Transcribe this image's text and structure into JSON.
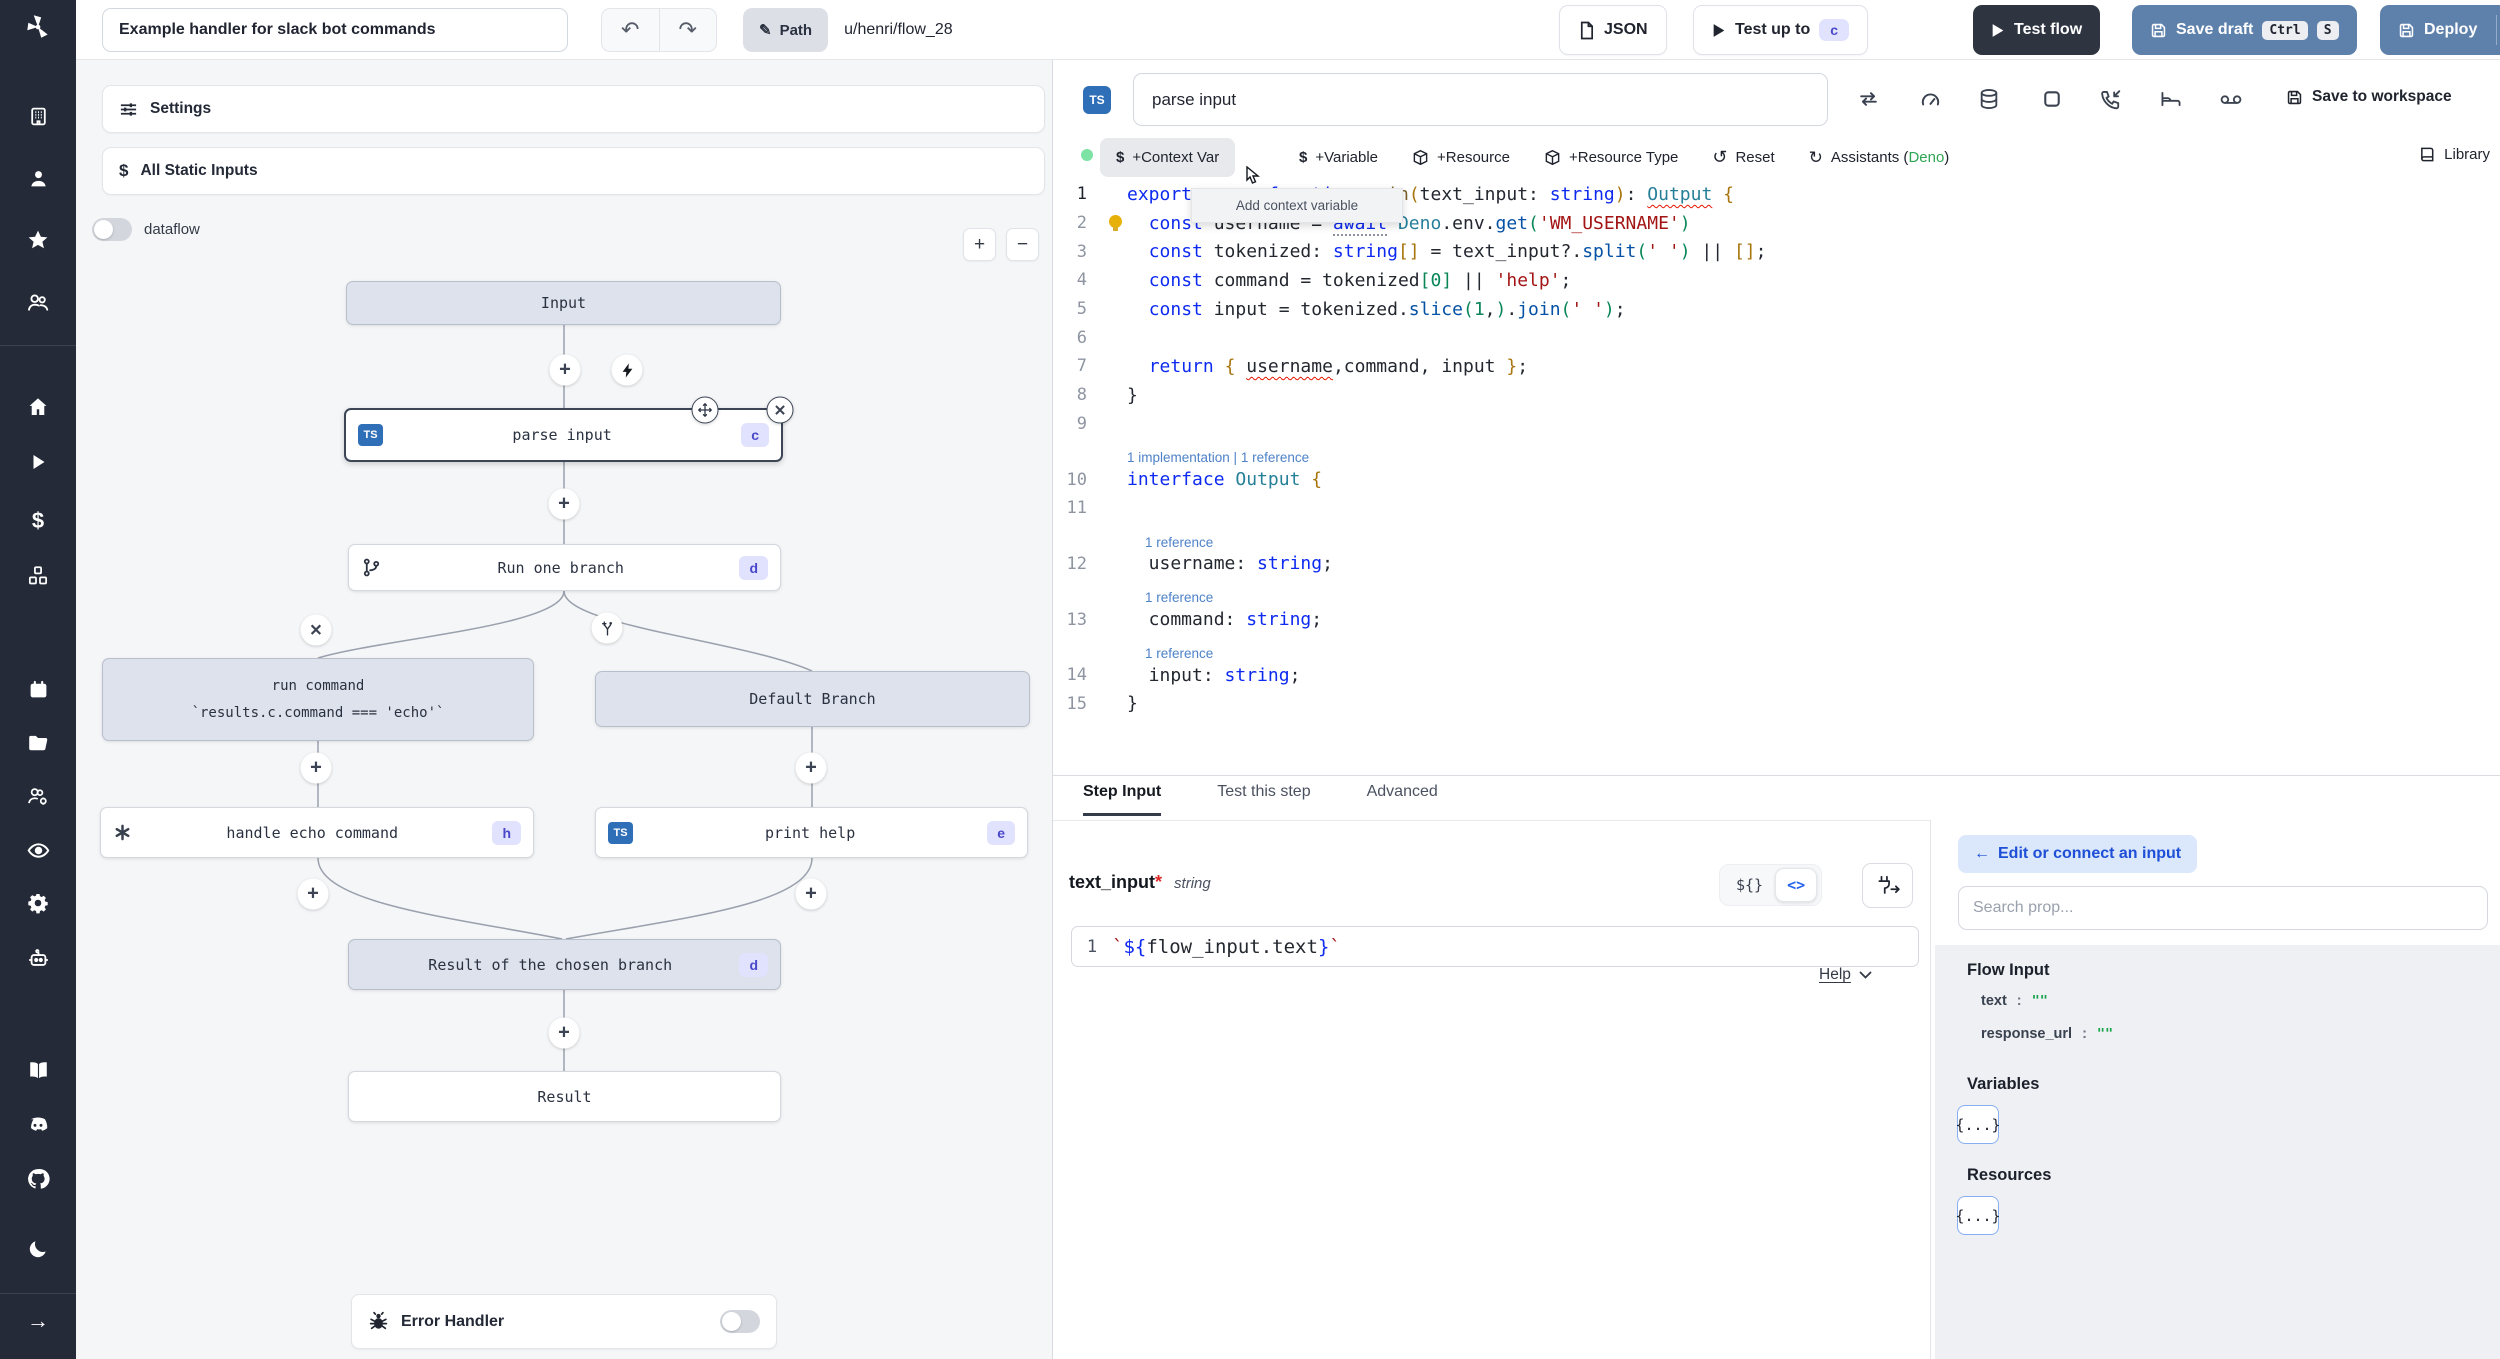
{
  "topbar": {
    "title": "Example handler for slack bot commands",
    "path_label": "Path",
    "path_value": "u/henri/flow_28",
    "json_label": "JSON",
    "test_up_to": "Test up to",
    "test_badge": "c",
    "test_flow": "Test flow",
    "save_draft": "Save draft",
    "kbd_ctrl": "Ctrl",
    "kbd_s": "S",
    "deploy": "Deploy"
  },
  "flow": {
    "settings": "Settings",
    "static_inputs": "All Static Inputs",
    "dataflow": "dataflow",
    "zoom_in": "+",
    "zoom_out": "−",
    "input_node": "Input",
    "parse": {
      "label": "parse input",
      "badge": "c",
      "lang": "TS"
    },
    "run_one": {
      "label": "Run one branch",
      "badge": "d"
    },
    "run_cmd": {
      "line1": "run command",
      "line2": "`results.c.command === 'echo'`"
    },
    "default_branch": "Default Branch",
    "echo": {
      "label": "handle echo command",
      "badge": "h"
    },
    "help": {
      "label": "print help",
      "badge": "e",
      "lang": "TS"
    },
    "result_branch": {
      "label": "Result of the chosen branch",
      "badge": "d"
    },
    "result": "Result",
    "error_handler": "Error Handler"
  },
  "editor": {
    "lang": "TS",
    "name": "parse input",
    "save_workspace": "Save to workspace",
    "btn_context": "+Context Var",
    "btn_variable": "+Variable",
    "btn_resource": "+Resource",
    "btn_resource_type": "+Resource Type",
    "btn_reset": "Reset",
    "assistants_pre": "Assistants (",
    "assistants_lang": "Deno",
    "assistants_post": ")",
    "library": "Library",
    "tooltip": "Add context variable",
    "icons": [
      "repeat",
      "gauge",
      "database",
      "square",
      "phone-incoming",
      "bed",
      "voicemail"
    ],
    "code_lines": [
      {
        "n": "1",
        "active": true,
        "tokens": [
          [
            "ck",
            "export"
          ],
          [
            "cp",
            " "
          ],
          [
            "ck",
            "async"
          ],
          [
            "cp",
            " "
          ],
          [
            "ck",
            "function"
          ],
          [
            "cp",
            " "
          ],
          [
            "cf",
            "main"
          ],
          [
            "cb",
            "("
          ],
          [
            "cp",
            "text_input"
          ],
          [
            "cp",
            ": "
          ],
          [
            "ck",
            "string"
          ],
          [
            "cb",
            ")"
          ],
          [
            "cp",
            ": "
          ],
          [
            "ct sq",
            "Output"
          ],
          [
            "cp",
            " "
          ],
          [
            "cb",
            "{"
          ]
        ]
      },
      {
        "n": "2",
        "bulb": true,
        "tokens": [
          [
            "cp",
            "  "
          ],
          [
            "ck",
            "const"
          ],
          [
            "cp",
            " username = "
          ],
          [
            "ck dotted",
            "await"
          ],
          [
            "cp",
            " "
          ],
          [
            "ct",
            "Deno"
          ],
          [
            "cp",
            ".env."
          ],
          [
            "cm",
            "get"
          ],
          [
            "cg",
            "("
          ],
          [
            "cs",
            "'WM_USERNAME'"
          ],
          [
            "cg",
            ")"
          ]
        ]
      },
      {
        "n": "3",
        "tokens": [
          [
            "cp",
            "  "
          ],
          [
            "ck",
            "const"
          ],
          [
            "cp",
            " tokenized: "
          ],
          [
            "ck",
            "string"
          ],
          [
            "cb",
            "[]"
          ],
          [
            "cp",
            " = text_input?."
          ],
          [
            "cm",
            "split"
          ],
          [
            "cg",
            "("
          ],
          [
            "cs",
            "' '"
          ],
          [
            "cg",
            ")"
          ],
          [
            "cp",
            " || "
          ],
          [
            "cb",
            "[]"
          ],
          [
            "cp",
            ";"
          ]
        ]
      },
      {
        "n": "4",
        "tokens": [
          [
            "cp",
            "  "
          ],
          [
            "ck",
            "const"
          ],
          [
            "cp",
            " command = tokenized"
          ],
          [
            "cg",
            "["
          ],
          [
            "cg",
            "0"
          ],
          [
            "cg",
            "]"
          ],
          [
            "cp",
            " || "
          ],
          [
            "cs",
            "'help'"
          ],
          [
            "cp",
            ";"
          ]
        ]
      },
      {
        "n": "5",
        "tokens": [
          [
            "cp",
            "  "
          ],
          [
            "ck",
            "const"
          ],
          [
            "cp",
            " input = tokenized."
          ],
          [
            "cm",
            "slice"
          ],
          [
            "cg",
            "("
          ],
          [
            "cg",
            "1"
          ],
          [
            "cp",
            ","
          ],
          [
            "cg",
            ")"
          ],
          [
            "cp",
            "."
          ],
          [
            "cm",
            "join"
          ],
          [
            "cg",
            "("
          ],
          [
            "cs",
            "' '"
          ],
          [
            "cg",
            ")"
          ],
          [
            "cp",
            ";"
          ]
        ]
      },
      {
        "n": "6",
        "tokens": []
      },
      {
        "n": "7",
        "tokens": [
          [
            "cp",
            "  "
          ],
          [
            "ck",
            "return"
          ],
          [
            "cp",
            " "
          ],
          [
            "cb",
            "{"
          ],
          [
            "cp",
            " "
          ],
          [
            "cp sq",
            "username"
          ],
          [
            "cp",
            ",command, input "
          ],
          [
            "cb",
            "}"
          ],
          [
            "cp",
            ";"
          ]
        ]
      },
      {
        "n": "8",
        "tokens": [
          [
            "cp",
            "}"
          ]
        ]
      },
      {
        "n": "9",
        "tokens": []
      },
      {
        "lens": "1 implementation | 1 reference",
        "indent": 0
      },
      {
        "n": "10",
        "tokens": [
          [
            "ck",
            "interface"
          ],
          [
            "cp",
            " "
          ],
          [
            "ct",
            "Output"
          ],
          [
            "cp",
            " "
          ],
          [
            "cb",
            "{"
          ]
        ]
      },
      {
        "n": "11",
        "tokens": []
      },
      {
        "lens": "1 reference",
        "indent": 1
      },
      {
        "n": "12",
        "tokens": [
          [
            "cp",
            "  username: "
          ],
          [
            "ck",
            "string"
          ],
          [
            "cp",
            ";"
          ]
        ]
      },
      {
        "lens": "1 reference",
        "indent": 1
      },
      {
        "n": "13",
        "tokens": [
          [
            "cp",
            "  command: "
          ],
          [
            "ck",
            "string"
          ],
          [
            "cp",
            ";"
          ]
        ]
      },
      {
        "lens": "1 reference",
        "indent": 1
      },
      {
        "n": "14",
        "tokens": [
          [
            "cp",
            "  input: "
          ],
          [
            "ck",
            "string"
          ],
          [
            "cp",
            ";"
          ]
        ]
      },
      {
        "n": "15",
        "tokens": [
          [
            "cp",
            "}"
          ]
        ]
      }
    ]
  },
  "step": {
    "tabs": [
      "Step Input",
      "Test this step",
      "Advanced"
    ],
    "field": "text_input",
    "required": "*",
    "type": "string",
    "seg_template": "${}",
    "seg_code": "<>",
    "expr_no": "1",
    "expr_tokens": [
      [
        "cs",
        "`"
      ],
      [
        "ck",
        "${"
      ],
      [
        "cp",
        "flow_input.text"
      ],
      [
        "ck",
        "}"
      ],
      [
        "cs",
        "`"
      ]
    ],
    "help": "Help"
  },
  "right": {
    "edit_connect": "Edit or connect an input",
    "search_placeholder": "Search prop...",
    "flow_input": "Flow Input",
    "props": [
      {
        "name": "text",
        "sep": ":",
        "value": "\"\""
      },
      {
        "name": "response_url",
        "sep": ":",
        "value": "\"\""
      }
    ],
    "variables": "Variables",
    "variables_chip": "{...}",
    "resources": "Resources",
    "resources_chip": "{...}"
  },
  "colors": {
    "accent_steel": "#5e81ac",
    "dark_button": "#2e3440",
    "badge_bg": "#e1e2fd",
    "badge_fg": "#4a48c9",
    "deno_green": "#2fa555",
    "ts_blue": "#2e6fb7"
  }
}
